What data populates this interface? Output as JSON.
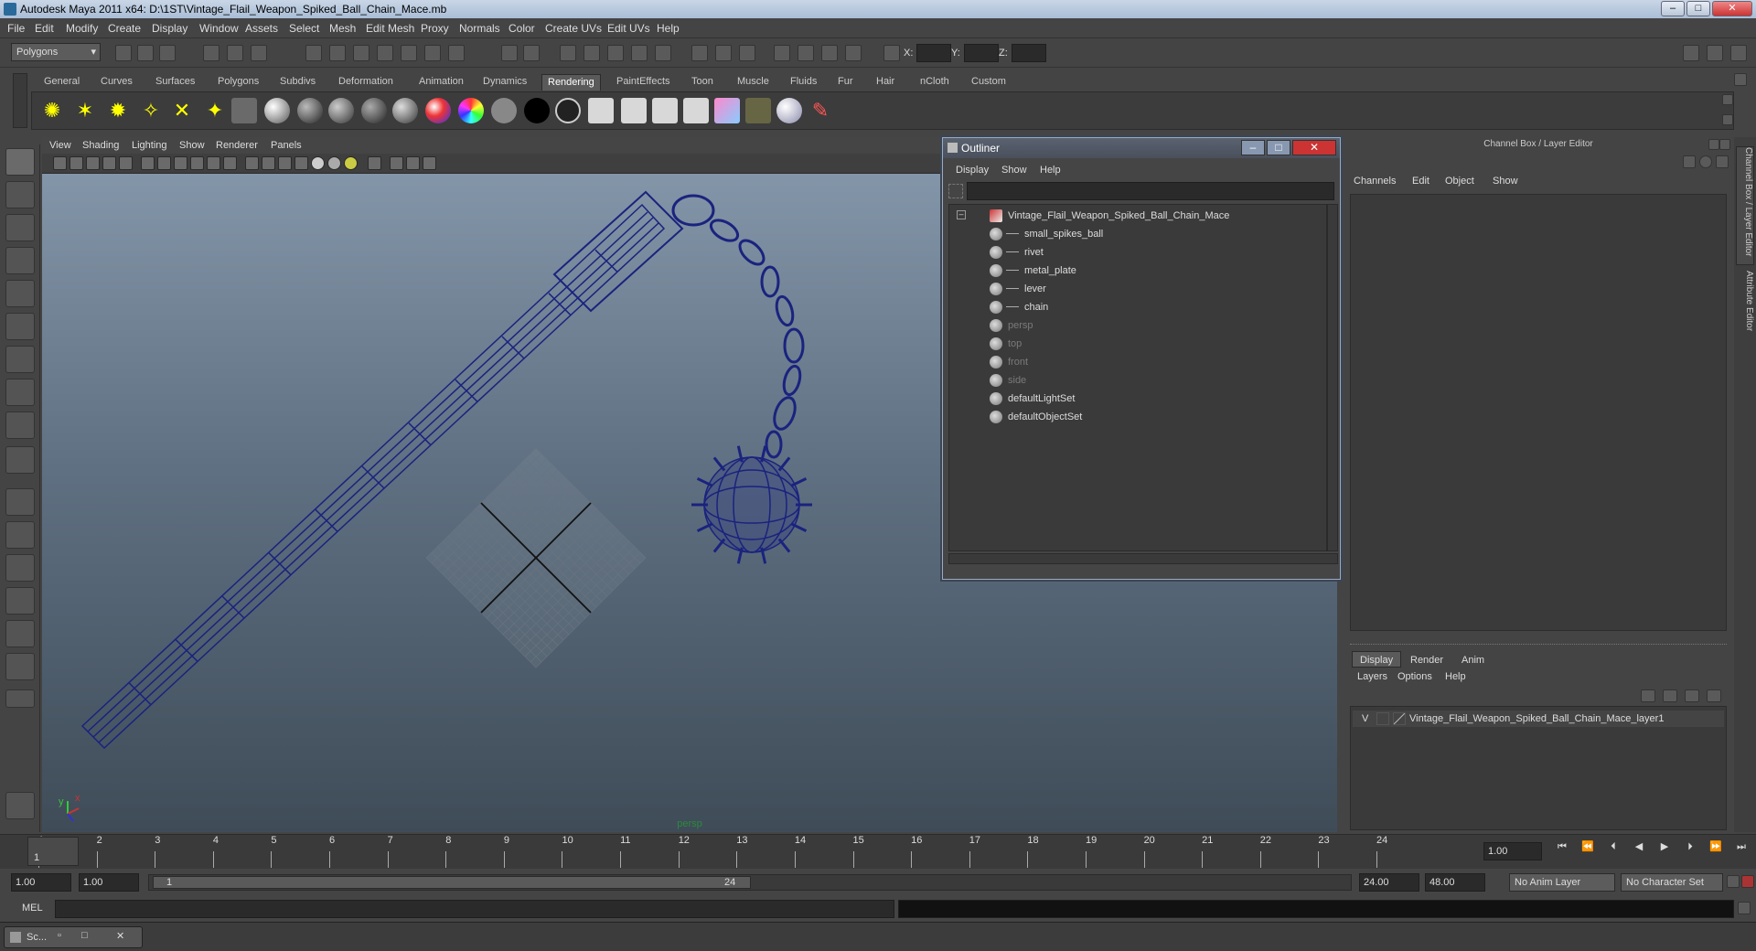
{
  "window": {
    "title": "Autodesk Maya 2011 x64: D:\\1ST\\Vintage_Flail_Weapon_Spiked_Ball_Chain_Mace.mb"
  },
  "menubar": [
    "File",
    "Edit",
    "Modify",
    "Create",
    "Display",
    "Window",
    "Assets",
    "Select",
    "Mesh",
    "Edit Mesh",
    "Proxy",
    "Normals",
    "Color",
    "Create UVs",
    "Edit UVs",
    "Help"
  ],
  "status_line": {
    "mode": "Polygons",
    "x_label": "X:",
    "y_label": "Y:",
    "z_label": "Z:"
  },
  "shelf_tabs": [
    "General",
    "Curves",
    "Surfaces",
    "Polygons",
    "Subdivs",
    "Deformation",
    "Animation",
    "Dynamics",
    "Rendering",
    "PaintEffects",
    "Toon",
    "Muscle",
    "Fluids",
    "Fur",
    "Hair",
    "nCloth",
    "Custom"
  ],
  "active_shelf_tab": "Rendering",
  "viewport": {
    "menu": [
      "View",
      "Shading",
      "Lighting",
      "Show",
      "Renderer",
      "Panels"
    ],
    "camera_label": "persp",
    "axis_y": "y",
    "axis_x": "x"
  },
  "outliner": {
    "title": "Outliner",
    "menu": [
      "Display",
      "Show",
      "Help"
    ],
    "items": [
      {
        "label": "Vintage_Flail_Weapon_Spiked_Ball_Chain_Mace",
        "indent": 0,
        "dim": false,
        "icon": "transform-icon"
      },
      {
        "label": "small_spikes_ball",
        "indent": 1,
        "dim": false,
        "icon": "mesh-icon"
      },
      {
        "label": "rivet",
        "indent": 1,
        "dim": false,
        "icon": "mesh-icon"
      },
      {
        "label": "metal_plate",
        "indent": 1,
        "dim": false,
        "icon": "mesh-icon"
      },
      {
        "label": "lever",
        "indent": 1,
        "dim": false,
        "icon": "mesh-icon"
      },
      {
        "label": "chain",
        "indent": 1,
        "dim": false,
        "icon": "mesh-icon"
      },
      {
        "label": "persp",
        "indent": 0,
        "dim": true,
        "icon": "camera-icon"
      },
      {
        "label": "top",
        "indent": 0,
        "dim": true,
        "icon": "camera-icon"
      },
      {
        "label": "front",
        "indent": 0,
        "dim": true,
        "icon": "camera-icon"
      },
      {
        "label": "side",
        "indent": 0,
        "dim": true,
        "icon": "camera-icon"
      },
      {
        "label": "defaultLightSet",
        "indent": 0,
        "dim": false,
        "icon": "set-icon"
      },
      {
        "label": "defaultObjectSet",
        "indent": 0,
        "dim": false,
        "icon": "set-icon"
      }
    ]
  },
  "channel_box": {
    "title": "Channel Box / Layer Editor",
    "menu": [
      "Channels",
      "Edit",
      "Object",
      "Show"
    ],
    "layer_tabs": [
      "Display",
      "Render",
      "Anim"
    ],
    "layer_menu": [
      "Layers",
      "Options",
      "Help"
    ],
    "layer_visible": "V",
    "layer_name": "Vintage_Flail_Weapon_Spiked_Ball_Chain_Mace_layer1",
    "side_tabs": [
      "Channel Box / Layer Editor",
      "Attribute Editor"
    ]
  },
  "timeline": {
    "ticks": [
      "1",
      "2",
      "3",
      "4",
      "5",
      "6",
      "7",
      "8",
      "9",
      "10",
      "11",
      "12",
      "13",
      "14",
      "15",
      "16",
      "17",
      "18",
      "19",
      "20",
      "21",
      "22",
      "23",
      "24"
    ],
    "current_frame_marker": "1",
    "current_time": "1.00"
  },
  "range": {
    "start": "1.00",
    "playback_start": "1.00",
    "slider_start": "1",
    "slider_end": "24",
    "playback_end": "24.00",
    "end": "48.00",
    "anim_layer": "No Anim Layer",
    "character_set": "No Character Set"
  },
  "command_line": {
    "label": "MEL"
  },
  "taskbar": {
    "item": "Sc..."
  },
  "colors": {
    "wire": "#1a237e",
    "accent": "#5a6270"
  }
}
